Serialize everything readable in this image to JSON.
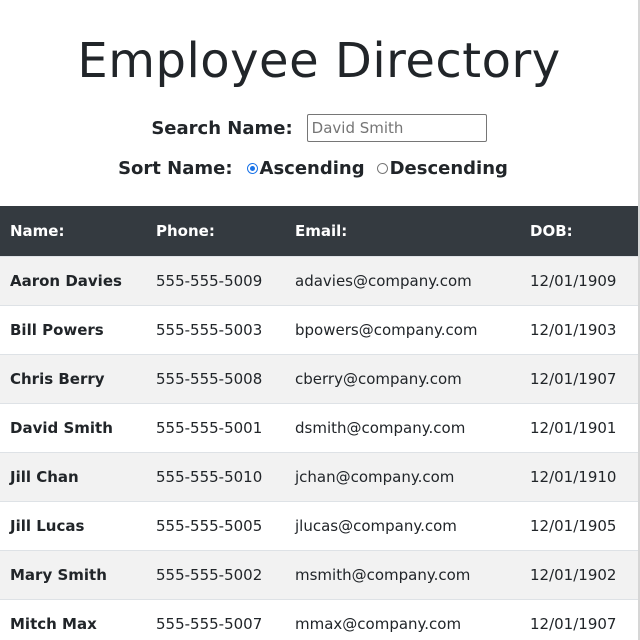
{
  "header": {
    "title": "Employee Directory"
  },
  "search": {
    "label": "Search Name:",
    "value": "",
    "placeholder": "David Smith"
  },
  "sort": {
    "label": "Sort Name:",
    "options": [
      {
        "label": "Ascending",
        "checked": true
      },
      {
        "label": "Descending",
        "checked": false
      }
    ]
  },
  "table": {
    "columns": [
      "Name:",
      "Phone:",
      "Email:",
      "DOB:"
    ],
    "rows": [
      {
        "name": "Aaron Davies",
        "phone": "555-555-5009",
        "email": "adavies@company.com",
        "dob": "12/01/1909"
      },
      {
        "name": "Bill Powers",
        "phone": "555-555-5003",
        "email": "bpowers@company.com",
        "dob": "12/01/1903"
      },
      {
        "name": "Chris Berry",
        "phone": "555-555-5008",
        "email": "cberry@company.com",
        "dob": "12/01/1907"
      },
      {
        "name": "David Smith",
        "phone": "555-555-5001",
        "email": "dsmith@company.com",
        "dob": "12/01/1901"
      },
      {
        "name": "Jill Chan",
        "phone": "555-555-5010",
        "email": "jchan@company.com",
        "dob": "12/01/1910"
      },
      {
        "name": "Jill Lucas",
        "phone": "555-555-5005",
        "email": "jlucas@company.com",
        "dob": "12/01/1905"
      },
      {
        "name": "Mary Smith",
        "phone": "555-555-5002",
        "email": "msmith@company.com",
        "dob": "12/01/1902"
      },
      {
        "name": "Mitch Max",
        "phone": "555-555-5007",
        "email": "mmax@company.com",
        "dob": "12/01/1907"
      }
    ]
  },
  "colors": {
    "header_bg": "#343a40",
    "stripe_bg": "#f2f2f2",
    "radio_accent": "#1a73e8"
  }
}
